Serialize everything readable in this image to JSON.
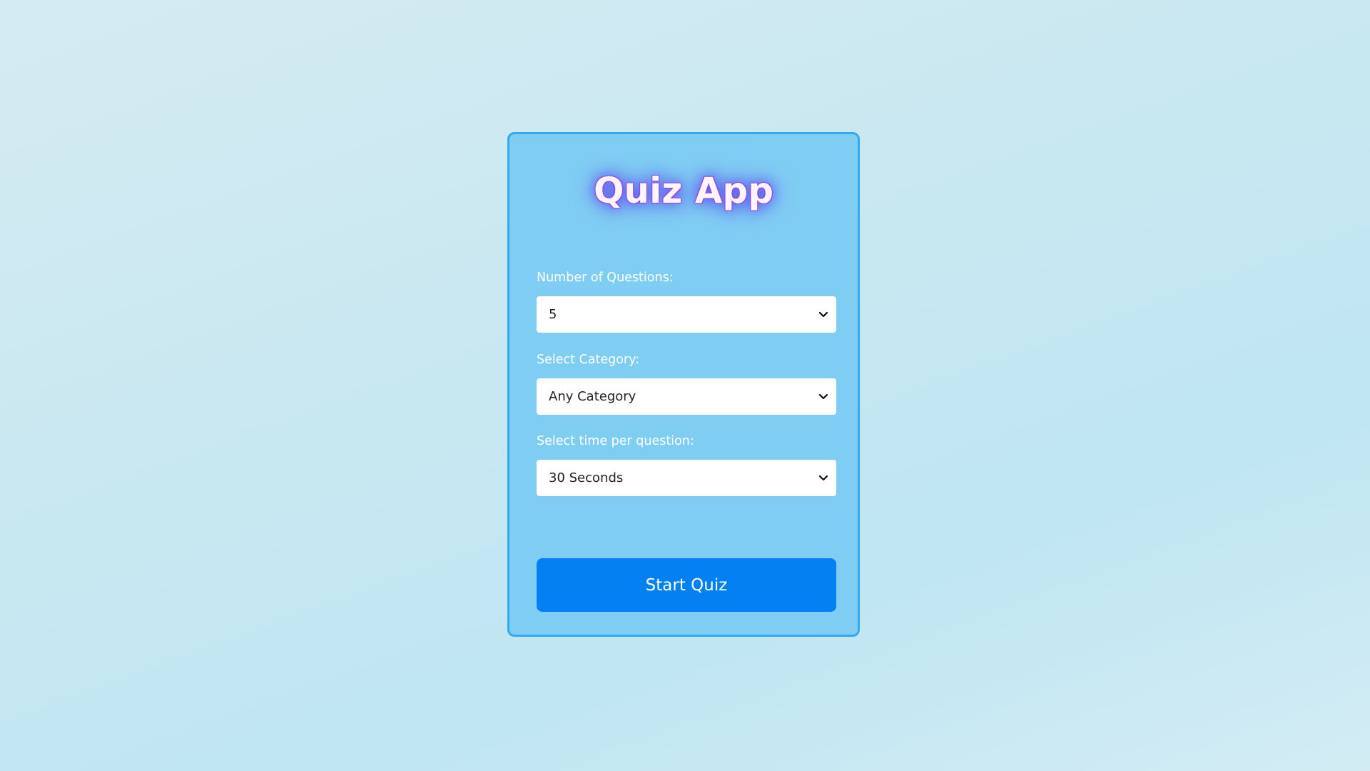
{
  "app": {
    "title": "Quiz App"
  },
  "form": {
    "questions_label": "Number of Questions:",
    "questions_value": "5",
    "category_label": "Select Category:",
    "category_value": "Any Category",
    "time_label": "Select time per question:",
    "time_value": "30 Seconds",
    "start_label": "Start Quiz"
  },
  "icons": {
    "select_arrow": "chevron-down-icon"
  },
  "colors": {
    "card_background": "#80cdf3",
    "card_border": "#33aaea",
    "button_background": "#0580f2",
    "title_glow": "#5a4cf0"
  }
}
